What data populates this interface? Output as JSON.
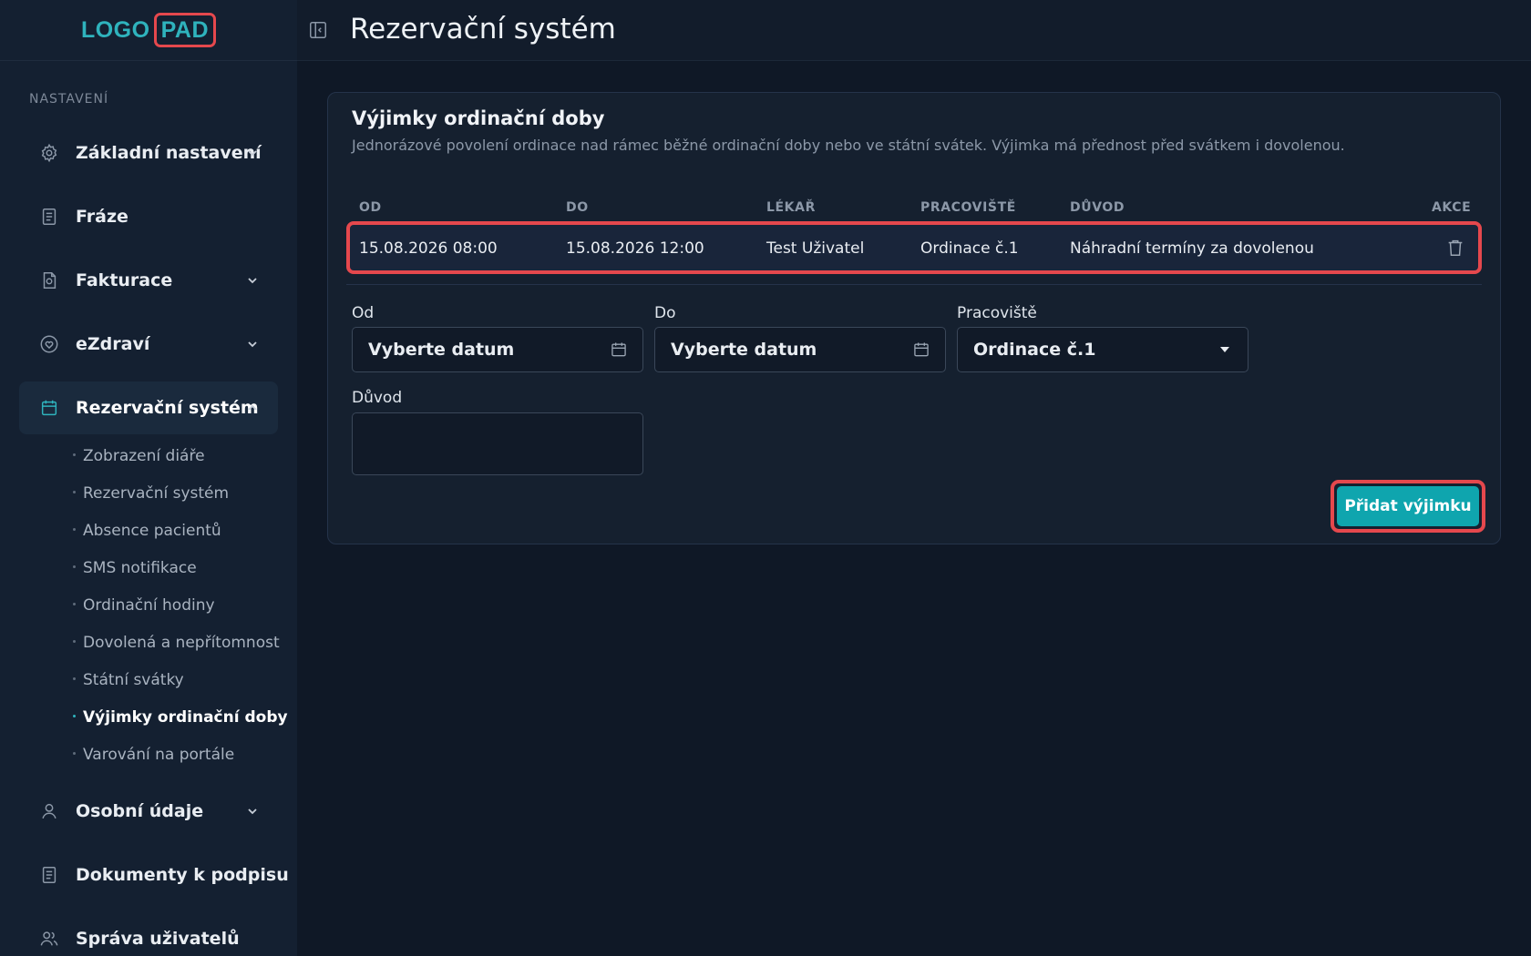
{
  "logo": {
    "part1": "LOGO",
    "part2": "PAD"
  },
  "sidebar": {
    "section_label": "NASTAVENÍ",
    "items": [
      {
        "label": "Základní nastavení",
        "icon": "gear-icon",
        "expandable": true
      },
      {
        "label": "Fráze",
        "icon": "document-icon",
        "expandable": false
      },
      {
        "label": "Fakturace",
        "icon": "invoice-icon",
        "expandable": true
      },
      {
        "label": "eZdraví",
        "icon": "heart-icon",
        "expandable": true
      },
      {
        "label": "Rezervační systém",
        "icon": "calendar-icon",
        "expandable": true,
        "active": true
      },
      {
        "label": "Osobní údaje",
        "icon": "user-icon",
        "expandable": true
      },
      {
        "label": "Dokumenty k podpisu",
        "icon": "document-icon",
        "expandable": false
      },
      {
        "label": "Správa uživatelů",
        "icon": "users-icon",
        "expandable": false
      }
    ],
    "sub_items": [
      {
        "label": "Zobrazení diáře"
      },
      {
        "label": "Rezervační systém"
      },
      {
        "label": "Absence pacientů"
      },
      {
        "label": "SMS notifikace"
      },
      {
        "label": "Ordinační hodiny"
      },
      {
        "label": "Dovolená a nepřítomnost"
      },
      {
        "label": "Státní svátky"
      },
      {
        "label": "Výjimky ordinační doby",
        "current": true
      },
      {
        "label": "Varování na portále"
      }
    ]
  },
  "header": {
    "title": "Rezervační systém"
  },
  "card": {
    "title": "Výjimky ordinační doby",
    "description": "Jednorázové povolení ordinace nad rámec běžné ordinační doby nebo ve státní svátek. Výjimka má přednost před svátkem i dovolenou.",
    "table": {
      "columns": [
        "OD",
        "DO",
        "LÉKAŘ",
        "PRACOVIŠTĚ",
        "DŮVOD",
        "AKCE"
      ],
      "rows": [
        {
          "od": "15.08.2026 08:00",
          "do": "15.08.2026 12:00",
          "lekar": "Test Uživatel",
          "pracoviste": "Ordinace č.1",
          "duvod": "Náhradní termíny za dovolenou"
        }
      ]
    },
    "form": {
      "od_label": "Od",
      "od_placeholder": "Vyberte datum",
      "do_label": "Do",
      "do_placeholder": "Vyberte datum",
      "pracoviste_label": "Pracoviště",
      "pracoviste_value": "Ordinace č.1",
      "duvod_label": "Důvod",
      "duvod_value": ""
    },
    "add_button": "Přidat výjimku"
  },
  "colors": {
    "accent": "#0fa5ae",
    "highlight": "#e5484d",
    "sidebar_bg": "#142031",
    "page_bg": "#0f1826"
  }
}
